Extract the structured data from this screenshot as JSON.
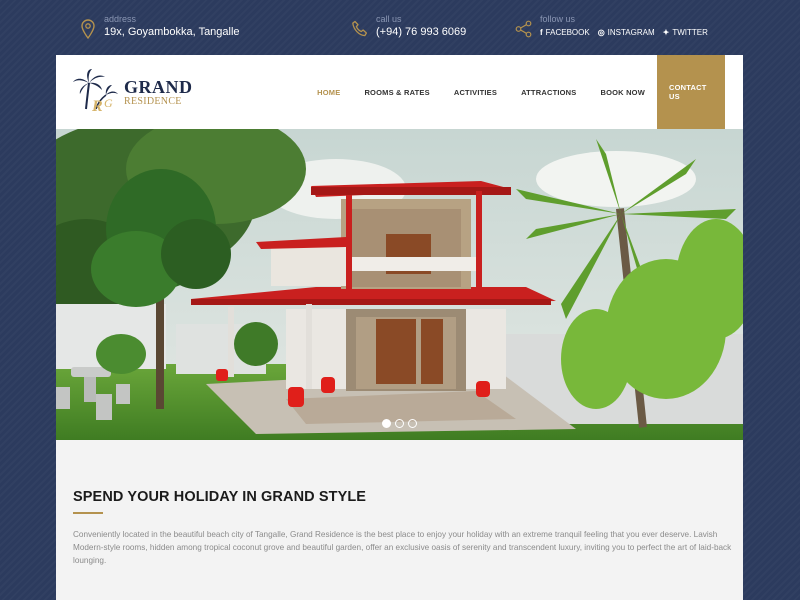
{
  "topbar": {
    "address_label": "address",
    "address_value": "19x, Goyambokka, Tangalle",
    "call_label": "call us",
    "call_value": "(+94) 76 993 6069",
    "follow_label": "follow us",
    "social": [
      {
        "glyph": "f",
        "label": "FACEBOOK",
        "icon": "facebook-icon"
      },
      {
        "glyph": "◎",
        "label": "INSTAGRAM",
        "icon": "instagram-icon"
      },
      {
        "glyph": "✦",
        "label": "TWITTER",
        "icon": "twitter-icon"
      }
    ]
  },
  "brand": {
    "name_line1": "GRAND",
    "name_line2": "RESIDENCE",
    "logo_icon": "palm-tree-logo-icon"
  },
  "nav": {
    "items": [
      "HOME",
      "ROOMS & RATES",
      "ACTIVITIES",
      "ATTRACTIONS",
      "BOOK NOW"
    ],
    "cta": "CONTACT US",
    "active": "HOME"
  },
  "slider": {
    "slide_count": 3,
    "current_slide": 1
  },
  "intro": {
    "heading": "SPEND YOUR HOLIDAY IN GRAND STYLE",
    "paragraph": "Conveniently located in the beautiful beach city of Tangalle, Grand Residence is the best place to enjoy your holiday with an extreme tranquil feeling that you ever deserve. Lavish Modern-style rooms, hidden among tropical coconut grove and beautiful garden, offer an exclusive oasis of serenity and transcendent luxury, inviting you to perfect the art of laid-back lounging."
  },
  "colors": {
    "accent": "#b4924e",
    "background": "#2c3b5e",
    "roof": "#c9201f"
  }
}
